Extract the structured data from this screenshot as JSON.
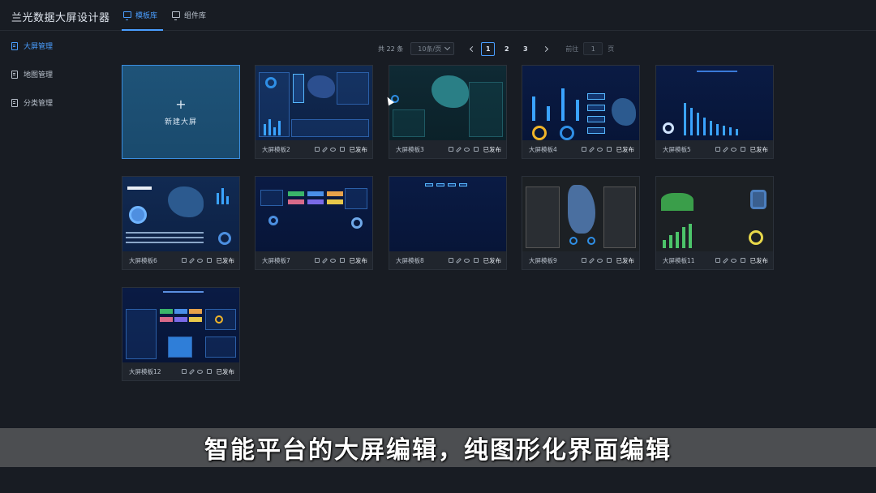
{
  "app": {
    "title": "兰光数据大屏设计器"
  },
  "top_tabs": [
    {
      "label": "模板库",
      "active": true,
      "icon": "monitor-icon"
    },
    {
      "label": "组件库",
      "active": false,
      "icon": "monitor-icon"
    }
  ],
  "sidebar": {
    "items": [
      {
        "label": "大屏管理",
        "active": true,
        "icon": "document-icon"
      },
      {
        "label": "地图管理",
        "active": false,
        "icon": "document-icon"
      },
      {
        "label": "分类管理",
        "active": false,
        "icon": "document-icon"
      }
    ]
  },
  "pagination": {
    "total_text": "共 22 条",
    "page_size": "10条/页",
    "pages": [
      "1",
      "2",
      "3"
    ],
    "current_page": "1",
    "goto_label": "前往",
    "goto_value": "1",
    "goto_unit": "页"
  },
  "new_card": {
    "plus": "+",
    "label": "新建大屏"
  },
  "templates": [
    {
      "name": "大屏模板2",
      "status": "已发布"
    },
    {
      "name": "大屏模板3",
      "status": "已发布"
    },
    {
      "name": "大屏模板4",
      "status": "已发布"
    },
    {
      "name": "大屏模板5",
      "status": "已发布"
    },
    {
      "name": "大屏模板6",
      "status": "已发布"
    },
    {
      "name": "大屏模板7",
      "status": "已发布"
    },
    {
      "name": "大屏模板8",
      "status": "已发布"
    },
    {
      "name": "大屏模板9",
      "status": "已发布"
    },
    {
      "name": "大屏模板11",
      "status": "已发布"
    },
    {
      "name": "大屏模板12",
      "status": "已发布"
    }
  ],
  "card_actions": [
    "delete-icon",
    "edit-icon",
    "preview-icon",
    "copy-icon"
  ],
  "subtitle": "智能平台的大屏编辑，纯图形化界面编辑",
  "colors": {
    "accent": "#4a9eff",
    "background": "#181c23",
    "card": "#20252d"
  }
}
